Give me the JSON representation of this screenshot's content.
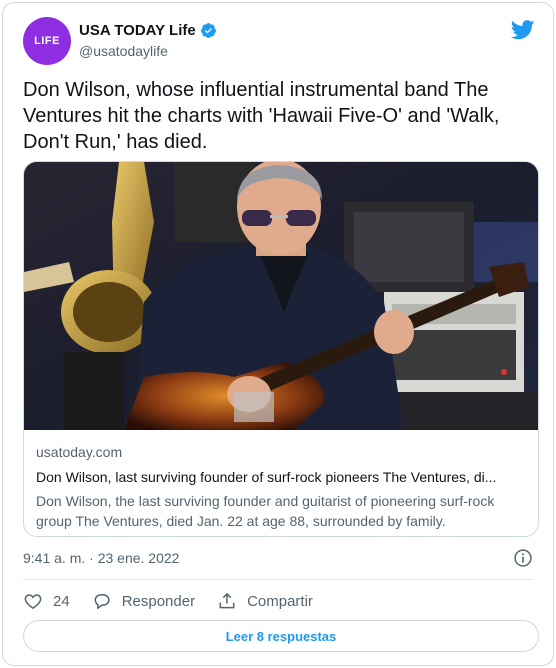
{
  "account": {
    "avatar_text": "LIFE",
    "display_name": "USA TODAY Life",
    "handle": "@usatodaylife",
    "verified": true
  },
  "tweet": {
    "text": "Don Wilson, whose influential instrumental band The Ventures hit the charts with 'Hawaii Five-O' and 'Walk, Don't Run,' has died."
  },
  "link_card": {
    "domain": "usatoday.com",
    "title": "Don Wilson, last surviving founder of surf-rock pioneers The Ventures, di...",
    "description": "Don Wilson, the last surviving founder and guitarist of pioneering surf-rock group The Ventures, died Jan. 22 at age 88, surrounded by family.",
    "image_subject": "man with tinted glasses playing electric guitar on stage"
  },
  "timestamp": "9:41 a. m. · 23 ene. 2022",
  "actions": {
    "like_count": "24",
    "reply_label": "Responder",
    "share_label": "Compartir"
  },
  "read_replies_label": "Leer 8 respuestas",
  "icons": {
    "brand": "twitter-bird-icon",
    "verified": "verified-badge-icon",
    "info": "info-icon",
    "like": "heart-icon",
    "reply": "speech-bubble-icon",
    "share": "share-icon"
  },
  "colors": {
    "twitter_blue": "#1d9bf0",
    "avatar_purple": "#8e2de2",
    "text_primary": "#0f1419",
    "text_secondary": "#536471",
    "border": "#cfd9de"
  }
}
